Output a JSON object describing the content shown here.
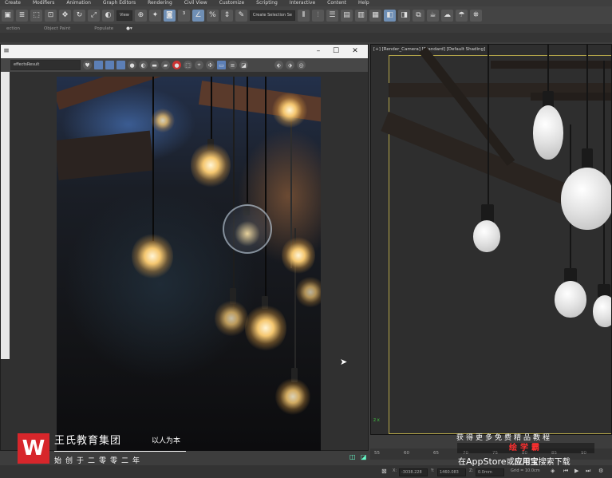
{
  "menubar": {
    "items": [
      "Create",
      "Modifiers",
      "Animation",
      "Graph Editors",
      "Rendering",
      "Civil View",
      "Customize",
      "Scripting",
      "Interactive",
      "Content",
      "Help"
    ]
  },
  "toolbar": {
    "view_dropdown": "View",
    "selection_set_placeholder": "Create Selection Se",
    "ribbon_labels": [
      "ection",
      "Object Paint",
      "Populate"
    ]
  },
  "render_frame": {
    "channel_dropdown": "effectsResult",
    "minimize": "–",
    "maximize": "☐",
    "close": "✕",
    "title_icon": "≡"
  },
  "viewport": {
    "label": "[+] [Render_Camera] [Standard] [Default Shading]",
    "axis_label": "z x"
  },
  "timeline": {
    "ticks": [
      "55",
      "60",
      "65",
      "70",
      "75",
      "80",
      "85",
      "90"
    ]
  },
  "status": {
    "x_label": "X:",
    "x_value": "-3038.228",
    "y_label": "Y:",
    "y_value": "1460.083",
    "z_label": "Z:",
    "z_value": "0.0mm",
    "grid": "Grid = 10.0cm"
  },
  "watermark": {
    "logo_letter": "W",
    "company": "王氏教育集团",
    "slogan": "以人为本",
    "founded": "始创于二零零二年",
    "right_line1": "获得更多免费精品教程",
    "right_line2": "绘学霸",
    "right_line3_prefix": "在",
    "right_line3_store": "AppStore",
    "right_line3_or": "或",
    "right_line3_app": "应用宝",
    "right_line3_suffix": "搜索下载"
  },
  "colors": {
    "logo_red": "#d7262b",
    "accent_blue": "#5c7fb6",
    "viewport_frame": "#b7a84a",
    "watermark_red": "#ff3030"
  }
}
